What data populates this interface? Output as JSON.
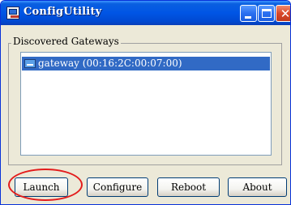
{
  "window": {
    "title": "ConfigUtility",
    "controls": {
      "minimize_icon": "minimize-icon",
      "maximize_icon": "maximize-icon",
      "close_icon": "close-icon"
    }
  },
  "groupbox": {
    "label": "Discovered Gateways",
    "items": [
      {
        "label": "gateway (00:16:2C:00:07:00)",
        "icon": "gateway-icon",
        "selected": true
      }
    ]
  },
  "buttons": {
    "launch": "Launch",
    "configure": "Configure",
    "reboot": "Reboot",
    "about": "About"
  },
  "colors": {
    "titlebar": "#0055e5",
    "selection": "#316ac5",
    "annotation": "#e31c1c"
  }
}
